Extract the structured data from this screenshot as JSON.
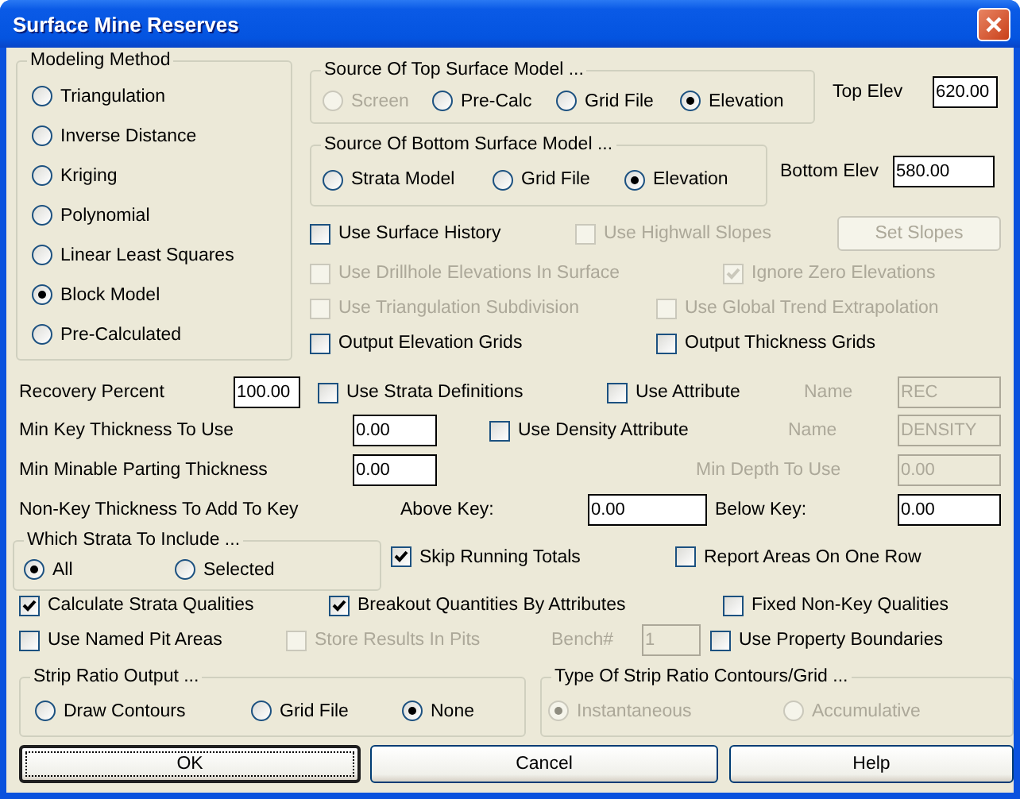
{
  "window": {
    "title": "Surface Mine Reserves"
  },
  "modeling_method": {
    "label": "Modeling Method",
    "options": [
      {
        "label": "Triangulation",
        "selected": false,
        "disabled": false
      },
      {
        "label": "Inverse Distance",
        "selected": false,
        "disabled": false
      },
      {
        "label": "Kriging",
        "selected": false,
        "disabled": false
      },
      {
        "label": "Polynomial",
        "selected": false,
        "disabled": false
      },
      {
        "label": "Linear Least Squares",
        "selected": false,
        "disabled": false
      },
      {
        "label": "Block Model",
        "selected": true,
        "disabled": false
      },
      {
        "label": "Pre-Calculated",
        "selected": false,
        "disabled": false
      }
    ]
  },
  "top_surface": {
    "label": "Source Of Top Surface Model ...",
    "options": [
      {
        "label": "Screen",
        "selected": false,
        "disabled": true
      },
      {
        "label": "Pre-Calc",
        "selected": false,
        "disabled": false
      },
      {
        "label": "Grid File",
        "selected": false,
        "disabled": false
      },
      {
        "label": "Elevation",
        "selected": true,
        "disabled": false
      }
    ]
  },
  "top_elev": {
    "label": "Top Elev",
    "value": "620.00",
    "disabled": false
  },
  "bottom_surface": {
    "label": "Source Of Bottom Surface Model ...",
    "options": [
      {
        "label": "Strata Model",
        "selected": false,
        "disabled": false
      },
      {
        "label": "Grid File",
        "selected": false,
        "disabled": false
      },
      {
        "label": "Elevation",
        "selected": true,
        "disabled": false
      }
    ]
  },
  "bottom_elev": {
    "label": "Bottom Elev",
    "value": "580.00",
    "disabled": false
  },
  "surface_options": [
    {
      "label": "Use Surface History",
      "checked": false,
      "disabled": false
    },
    {
      "label": "Use Highwall Slopes",
      "checked": false,
      "disabled": true
    },
    {
      "label": "Use Drillhole Elevations In Surface",
      "checked": false,
      "disabled": true
    },
    {
      "label": "Ignore Zero Elevations",
      "checked": true,
      "disabled": true
    },
    {
      "label": "Use Triangulation Subdivision",
      "checked": false,
      "disabled": true
    },
    {
      "label": "Use Global Trend Extrapolation",
      "checked": false,
      "disabled": true
    },
    {
      "label": "Output Elevation Grids",
      "checked": false,
      "disabled": false
    },
    {
      "label": "Output Thickness Grids",
      "checked": false,
      "disabled": false
    }
  ],
  "set_slopes_button": {
    "label": "Set Slopes",
    "disabled": true
  },
  "recovery_percent": {
    "label": "Recovery Percent",
    "value": "100.00",
    "disabled": false
  },
  "use_strata_definitions": {
    "label": "Use Strata Definitions",
    "checked": false,
    "disabled": false
  },
  "use_attribute": {
    "label": "Use Attribute",
    "checked": false,
    "disabled": false
  },
  "attribute_name": {
    "label": "Name",
    "value": "REC",
    "disabled": true
  },
  "min_key_thickness": {
    "label": "Min Key Thickness To Use",
    "value": "0.00",
    "disabled": false
  },
  "use_density_attribute": {
    "label": "Use Density Attribute",
    "checked": false,
    "disabled": false
  },
  "density_name": {
    "label": "Name",
    "value": "DENSITY",
    "disabled": true
  },
  "min_parting_thickness": {
    "label": "Min Minable Parting Thickness",
    "value": "0.00",
    "disabled": false
  },
  "min_depth": {
    "label": "Min Depth To Use",
    "value": "0.00",
    "disabled": true
  },
  "non_key_thickness": {
    "label": "Non-Key Thickness To Add To Key",
    "above_key": {
      "label": "Above Key:",
      "value": "0.00",
      "disabled": false
    },
    "below_key": {
      "label": "Below Key:",
      "value": "0.00",
      "disabled": false
    }
  },
  "strata_include": {
    "label": "Which Strata To Include ...",
    "options": [
      {
        "label": "All",
        "selected": true,
        "disabled": false
      },
      {
        "label": "Selected",
        "selected": false,
        "disabled": false
      }
    ]
  },
  "skip_running_totals": {
    "label": "Skip Running Totals",
    "checked": true,
    "disabled": false
  },
  "report_areas_one_row": {
    "label": "Report Areas On One Row",
    "checked": false,
    "disabled": false
  },
  "calculate_strata_qualities": {
    "label": "Calculate Strata Qualities",
    "checked": true,
    "disabled": false
  },
  "breakout_quantities": {
    "label": "Breakout Quantities By Attributes",
    "checked": true,
    "disabled": false
  },
  "fixed_non_key_qualities": {
    "label": "Fixed Non-Key Qualities",
    "checked": false,
    "disabled": false
  },
  "use_named_pit_areas": {
    "label": "Use Named Pit Areas",
    "checked": false,
    "disabled": false
  },
  "store_results_in_pits": {
    "label": "Store Results In Pits",
    "checked": false,
    "disabled": true
  },
  "bench": {
    "label": "Bench#",
    "value": "1",
    "disabled": true
  },
  "use_property_boundaries": {
    "label": "Use Property Boundaries",
    "checked": false,
    "disabled": false
  },
  "strip_ratio_output": {
    "label": "Strip Ratio Output ...",
    "options": [
      {
        "label": "Draw Contours",
        "selected": false,
        "disabled": false
      },
      {
        "label": "Grid File",
        "selected": false,
        "disabled": false
      },
      {
        "label": "None",
        "selected": true,
        "disabled": false
      }
    ]
  },
  "strip_ratio_type": {
    "label": "Type Of Strip Ratio Contours/Grid ...",
    "options": [
      {
        "label": "Instantaneous",
        "selected": true,
        "disabled": true
      },
      {
        "label": "Accumulative",
        "selected": false,
        "disabled": true
      }
    ]
  },
  "buttons": [
    {
      "label": "OK",
      "default": true
    },
    {
      "label": "Cancel",
      "default": false
    },
    {
      "label": "Help",
      "default": false
    }
  ]
}
